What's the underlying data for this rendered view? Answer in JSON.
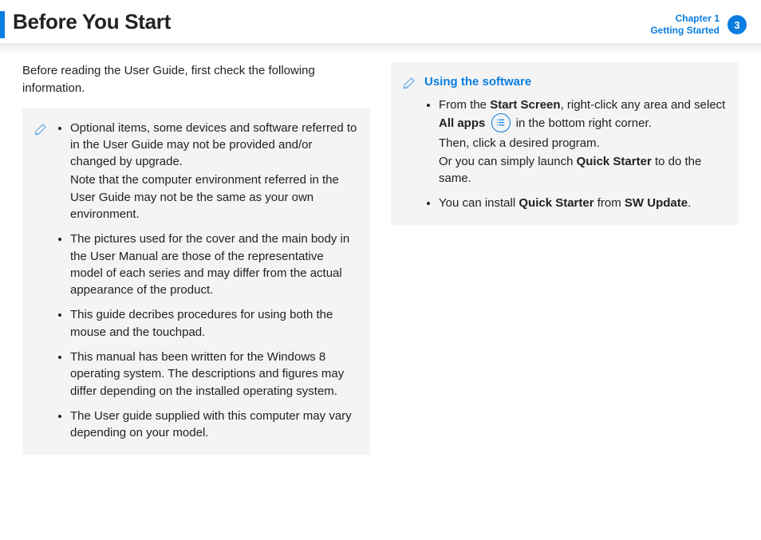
{
  "header": {
    "title": "Before You Start",
    "chapter_line1": "Chapter 1",
    "chapter_line2": "Getting Started",
    "page_number": "3"
  },
  "left": {
    "intro": "Before reading the User Guide, first check the following information.",
    "items": [
      {
        "text": "Optional items, some devices and software referred to in the User Guide may not be provided and/or changed by upgrade.",
        "sub": "Note that the computer environment referred in the User Guide may not be the same as your own environment."
      },
      {
        "text": "The pictures used for the cover and the main body in the User Manual are those of the representative model of each series and may differ from the actual appearance of the product."
      },
      {
        "text": "This guide decribes procedures for using both the mouse and the touchpad."
      },
      {
        "text": "This manual has been written for the Windows 8 operating system. The descriptions and figures may differ depending on the installed operating system."
      },
      {
        "text": "The User guide supplied with this computer may vary depending on your model."
      }
    ]
  },
  "right": {
    "box_title": "Using the software",
    "item1": {
      "pre": "From the ",
      "bold1": "Start Screen",
      "mid1": ", right-click any area and select ",
      "bold2": "All apps",
      "post_icon": " in the bottom right corner.",
      "line2": "Then, click a desired program.",
      "line3_pre": "Or you can simply launch ",
      "line3_bold": "Quick Starter",
      "line3_post": " to do the same."
    },
    "item2": {
      "pre": "You can install ",
      "bold1": "Quick Starter",
      "mid": " from ",
      "bold2": "SW Update",
      "post": "."
    }
  }
}
